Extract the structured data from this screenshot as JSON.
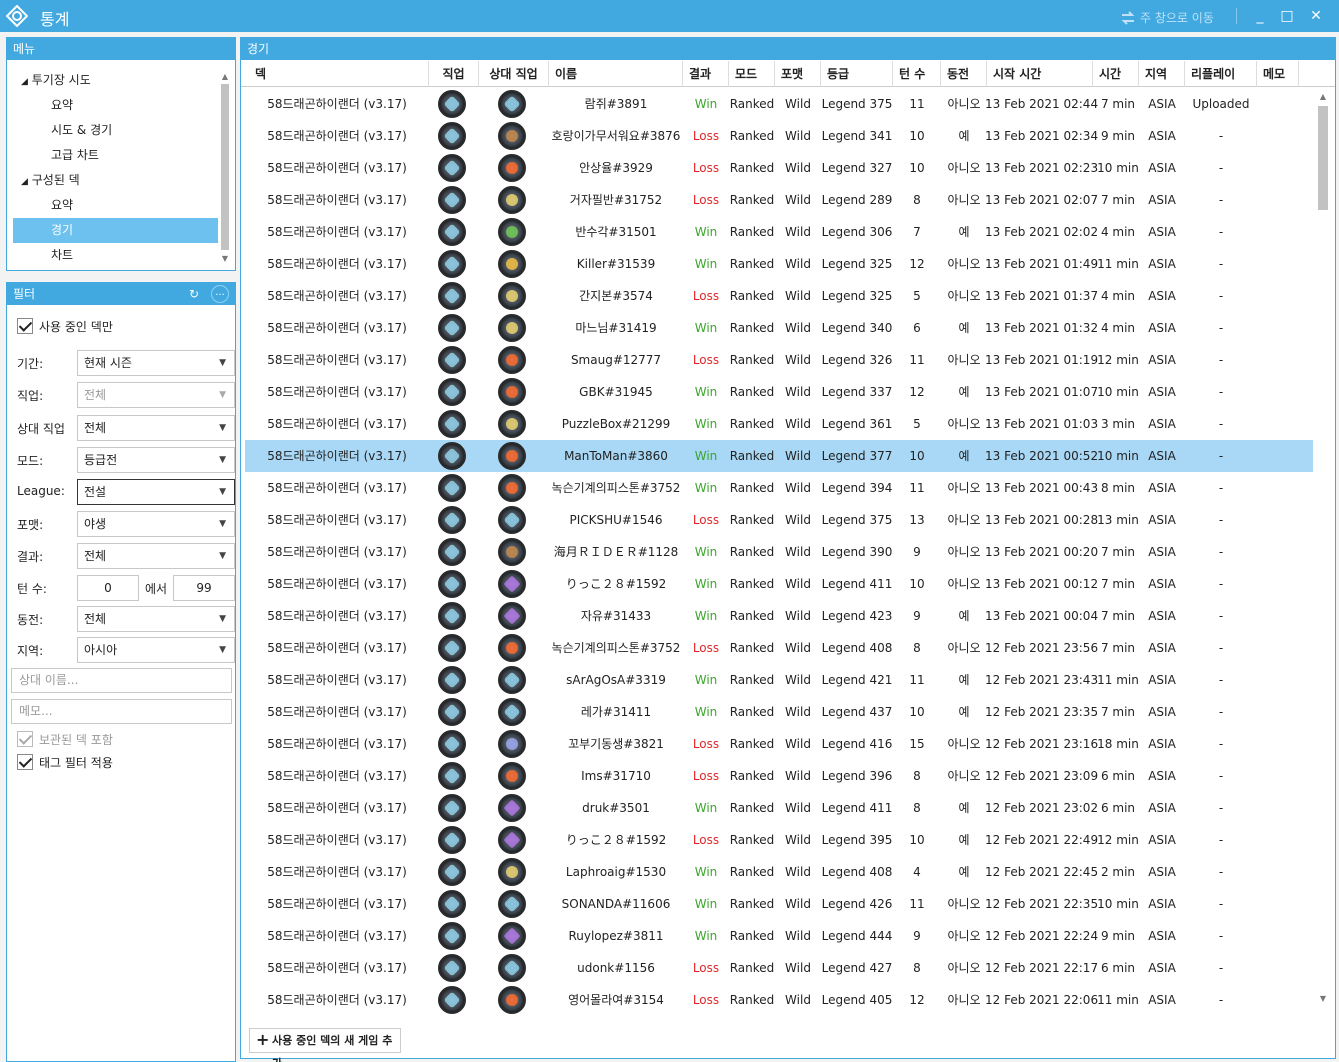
{
  "window": {
    "title": "통계",
    "goto_main": "주 창으로 이동",
    "minimize": "_",
    "maximize": "□",
    "close": "✕"
  },
  "menu": {
    "header": "메뉴",
    "items": [
      {
        "label": "투기장 시도",
        "expander": "◢"
      },
      {
        "label": "요약"
      },
      {
        "label": "시도 & 경기"
      },
      {
        "label": "고급 차트"
      },
      {
        "label": "구성된 덱",
        "expander": "◢"
      },
      {
        "label": "요약"
      },
      {
        "label": "경기"
      },
      {
        "label": "차트"
      }
    ]
  },
  "filter": {
    "header": "필터",
    "refresh_icon": "↻",
    "more": "...",
    "active_deck_only": "사용 중인 덱만",
    "period_label": "기간:",
    "period_value": "현재 시즌",
    "class_label": "직업:",
    "class_value": "전체",
    "opp_class_label": "상대 직업",
    "opp_class_value": "전체",
    "mode_label": "모드:",
    "mode_value": "등급전",
    "league_label": "League:",
    "league_value": "전설",
    "format_label": "포맷:",
    "format_value": "야생",
    "result_label": "결과:",
    "result_value": "전체",
    "turns_label": "턴 수:",
    "turns_from": "0",
    "turns_sep": "에서",
    "turns_to": "99",
    "coin_label": "동전:",
    "coin_value": "전체",
    "region_label": "지역:",
    "region_value": "아시아",
    "opponent_placeholder": "상대 이름...",
    "note_placeholder": "메모...",
    "include_archived": "보관된 덱 포함",
    "apply_tag_filter": "태그 필터 적용"
  },
  "games": {
    "header": "경기",
    "columns": [
      "덱",
      "직업",
      "상대 직업",
      "이름",
      "결과",
      "모드",
      "포맷",
      "등급",
      "턴 수",
      "동전",
      "시작 시간",
      "시간",
      "지역",
      "리플레이",
      "메모"
    ],
    "add_button": "사용 중인 덱의 새 게임 추가",
    "selected_index": 11,
    "rows": [
      {
        "deck": "58드래곤하이랜더 (v3.17)",
        "cls": "mage",
        "opp": "mage",
        "name": "람쥐#3891",
        "result": "Win",
        "mode": "Ranked",
        "format": "Wild",
        "rank": "Legend 375",
        "turns": "11",
        "coin": "아니오",
        "start": "13 Feb 2021 02:44",
        "duration": "7 min",
        "region": "ASIA",
        "replay": "Uploaded"
      },
      {
        "deck": "58드래곤하이랜더 (v3.17)",
        "cls": "mage",
        "opp": "rogue",
        "name": "호랑이가무서워요#3876",
        "result": "Loss",
        "mode": "Ranked",
        "format": "Wild",
        "rank": "Legend 341",
        "turns": "10",
        "coin": "예",
        "start": "13 Feb 2021 02:34",
        "duration": "9 min",
        "region": "ASIA",
        "replay": "-"
      },
      {
        "deck": "58드래곤하이랜더 (v3.17)",
        "cls": "mage",
        "opp": "warlock",
        "name": "안상율#3929",
        "result": "Loss",
        "mode": "Ranked",
        "format": "Wild",
        "rank": "Legend 327",
        "turns": "10",
        "coin": "아니오",
        "start": "13 Feb 2021 02:23",
        "duration": "10 min",
        "region": "ASIA",
        "replay": "-"
      },
      {
        "deck": "58드래곤하이랜더 (v3.17)",
        "cls": "mage",
        "opp": "druid",
        "name": "거자필반#31752",
        "result": "Loss",
        "mode": "Ranked",
        "format": "Wild",
        "rank": "Legend 289",
        "turns": "8",
        "coin": "아니오",
        "start": "13 Feb 2021 02:07",
        "duration": "7 min",
        "region": "ASIA",
        "replay": "-"
      },
      {
        "deck": "58드래곤하이랜더 (v3.17)",
        "cls": "mage",
        "opp": "hunter",
        "name": "반수각#31501",
        "result": "Win",
        "mode": "Ranked",
        "format": "Wild",
        "rank": "Legend 306",
        "turns": "7",
        "coin": "예",
        "start": "13 Feb 2021 02:02",
        "duration": "4 min",
        "region": "ASIA",
        "replay": "-"
      },
      {
        "deck": "58드래곤하이랜더 (v3.17)",
        "cls": "mage",
        "opp": "paladin",
        "name": "Killer#31539",
        "result": "Win",
        "mode": "Ranked",
        "format": "Wild",
        "rank": "Legend 325",
        "turns": "12",
        "coin": "아니오",
        "start": "13 Feb 2021 01:49",
        "duration": "11 min",
        "region": "ASIA",
        "replay": "-"
      },
      {
        "deck": "58드래곤하이랜더 (v3.17)",
        "cls": "mage",
        "opp": "druid",
        "name": "간지본#3574",
        "result": "Loss",
        "mode": "Ranked",
        "format": "Wild",
        "rank": "Legend 325",
        "turns": "5",
        "coin": "아니오",
        "start": "13 Feb 2021 01:37",
        "duration": "4 min",
        "region": "ASIA",
        "replay": "-"
      },
      {
        "deck": "58드래곤하이랜더 (v3.17)",
        "cls": "mage",
        "opp": "druid",
        "name": "마느님#31419",
        "result": "Win",
        "mode": "Ranked",
        "format": "Wild",
        "rank": "Legend 340",
        "turns": "6",
        "coin": "예",
        "start": "13 Feb 2021 01:32",
        "duration": "4 min",
        "region": "ASIA",
        "replay": "-"
      },
      {
        "deck": "58드래곤하이랜더 (v3.17)",
        "cls": "mage",
        "opp": "warlock",
        "name": "Smaug#12777",
        "result": "Loss",
        "mode": "Ranked",
        "format": "Wild",
        "rank": "Legend 326",
        "turns": "11",
        "coin": "아니오",
        "start": "13 Feb 2021 01:19",
        "duration": "12 min",
        "region": "ASIA",
        "replay": "-"
      },
      {
        "deck": "58드래곤하이랜더 (v3.17)",
        "cls": "mage",
        "opp": "warlock",
        "name": "GBK#31945",
        "result": "Win",
        "mode": "Ranked",
        "format": "Wild",
        "rank": "Legend 337",
        "turns": "12",
        "coin": "예",
        "start": "13 Feb 2021 01:07",
        "duration": "10 min",
        "region": "ASIA",
        "replay": "-"
      },
      {
        "deck": "58드래곤하이랜더 (v3.17)",
        "cls": "mage",
        "opp": "druid",
        "name": "PuzzleBox#21299",
        "result": "Win",
        "mode": "Ranked",
        "format": "Wild",
        "rank": "Legend 361",
        "turns": "5",
        "coin": "아니오",
        "start": "13 Feb 2021 01:03",
        "duration": "3 min",
        "region": "ASIA",
        "replay": "-"
      },
      {
        "deck": "58드래곤하이랜더 (v3.17)",
        "cls": "mage",
        "opp": "warlock",
        "name": "ManToMan#3860",
        "result": "Win",
        "mode": "Ranked",
        "format": "Wild",
        "rank": "Legend 377",
        "turns": "10",
        "coin": "예",
        "start": "13 Feb 2021 00:52",
        "duration": "10 min",
        "region": "ASIA",
        "replay": "-"
      },
      {
        "deck": "58드래곤하이랜더 (v3.17)",
        "cls": "mage",
        "opp": "warlock",
        "name": "녹슨기계의피스톤#3752",
        "result": "Win",
        "mode": "Ranked",
        "format": "Wild",
        "rank": "Legend 394",
        "turns": "11",
        "coin": "아니오",
        "start": "13 Feb 2021 00:43",
        "duration": "8 min",
        "region": "ASIA",
        "replay": "-"
      },
      {
        "deck": "58드래곤하이랜더 (v3.17)",
        "cls": "mage",
        "opp": "mage",
        "name": "PICKSHU#1546",
        "result": "Loss",
        "mode": "Ranked",
        "format": "Wild",
        "rank": "Legend 375",
        "turns": "13",
        "coin": "아니오",
        "start": "13 Feb 2021 00:28",
        "duration": "13 min",
        "region": "ASIA",
        "replay": "-"
      },
      {
        "deck": "58드래곤하이랜더 (v3.17)",
        "cls": "mage",
        "opp": "rogue",
        "name": "海月ＲＩＤＥＲ#1128",
        "result": "Win",
        "mode": "Ranked",
        "format": "Wild",
        "rank": "Legend 390",
        "turns": "9",
        "coin": "아니오",
        "start": "13 Feb 2021 00:20",
        "duration": "7 min",
        "region": "ASIA",
        "replay": "-"
      },
      {
        "deck": "58드래곤하이랜더 (v3.17)",
        "cls": "mage",
        "opp": "shaman",
        "name": "りっこ２８#1592",
        "result": "Win",
        "mode": "Ranked",
        "format": "Wild",
        "rank": "Legend 411",
        "turns": "10",
        "coin": "아니오",
        "start": "13 Feb 2021 00:12",
        "duration": "7 min",
        "region": "ASIA",
        "replay": "-"
      },
      {
        "deck": "58드래곤하이랜더 (v3.17)",
        "cls": "mage",
        "opp": "shaman",
        "name": "자유#31433",
        "result": "Win",
        "mode": "Ranked",
        "format": "Wild",
        "rank": "Legend 423",
        "turns": "9",
        "coin": "예",
        "start": "13 Feb 2021 00:04",
        "duration": "7 min",
        "region": "ASIA",
        "replay": "-"
      },
      {
        "deck": "58드래곤하이랜더 (v3.17)",
        "cls": "mage",
        "opp": "warlock",
        "name": "녹슨기계의피스톤#3752",
        "result": "Loss",
        "mode": "Ranked",
        "format": "Wild",
        "rank": "Legend 408",
        "turns": "8",
        "coin": "아니오",
        "start": "12 Feb 2021 23:56",
        "duration": "7 min",
        "region": "ASIA",
        "replay": "-"
      },
      {
        "deck": "58드래곤하이랜더 (v3.17)",
        "cls": "mage",
        "opp": "mage",
        "name": "sArAgOsA#3319",
        "result": "Win",
        "mode": "Ranked",
        "format": "Wild",
        "rank": "Legend 421",
        "turns": "11",
        "coin": "예",
        "start": "12 Feb 2021 23:43",
        "duration": "11 min",
        "region": "ASIA",
        "replay": "-"
      },
      {
        "deck": "58드래곤하이랜더 (v3.17)",
        "cls": "mage",
        "opp": "mage",
        "name": "레가#31411",
        "result": "Win",
        "mode": "Ranked",
        "format": "Wild",
        "rank": "Legend 437",
        "turns": "10",
        "coin": "예",
        "start": "12 Feb 2021 23:35",
        "duration": "7 min",
        "region": "ASIA",
        "replay": "-"
      },
      {
        "deck": "58드래곤하이랜더 (v3.17)",
        "cls": "mage",
        "opp": "priest",
        "name": "꼬부기동생#3821",
        "result": "Loss",
        "mode": "Ranked",
        "format": "Wild",
        "rank": "Legend 416",
        "turns": "15",
        "coin": "아니오",
        "start": "12 Feb 2021 23:16",
        "duration": "18 min",
        "region": "ASIA",
        "replay": "-"
      },
      {
        "deck": "58드래곤하이랜더 (v3.17)",
        "cls": "mage",
        "opp": "warlock",
        "name": "Ims#31710",
        "result": "Loss",
        "mode": "Ranked",
        "format": "Wild",
        "rank": "Legend 396",
        "turns": "8",
        "coin": "아니오",
        "start": "12 Feb 2021 23:09",
        "duration": "6 min",
        "region": "ASIA",
        "replay": "-"
      },
      {
        "deck": "58드래곤하이랜더 (v3.17)",
        "cls": "mage",
        "opp": "shaman",
        "name": "druk#3501",
        "result": "Win",
        "mode": "Ranked",
        "format": "Wild",
        "rank": "Legend 411",
        "turns": "8",
        "coin": "예",
        "start": "12 Feb 2021 23:02",
        "duration": "6 min",
        "region": "ASIA",
        "replay": "-"
      },
      {
        "deck": "58드래곤하이랜더 (v3.17)",
        "cls": "mage",
        "opp": "shaman",
        "name": "りっこ２８#1592",
        "result": "Loss",
        "mode": "Ranked",
        "format": "Wild",
        "rank": "Legend 395",
        "turns": "10",
        "coin": "예",
        "start": "12 Feb 2021 22:49",
        "duration": "12 min",
        "region": "ASIA",
        "replay": "-"
      },
      {
        "deck": "58드래곤하이랜더 (v3.17)",
        "cls": "mage",
        "opp": "druid",
        "name": "Laphroaig#1530",
        "result": "Win",
        "mode": "Ranked",
        "format": "Wild",
        "rank": "Legend 408",
        "turns": "4",
        "coin": "예",
        "start": "12 Feb 2021 22:45",
        "duration": "2 min",
        "region": "ASIA",
        "replay": "-"
      },
      {
        "deck": "58드래곤하이랜더 (v3.17)",
        "cls": "mage",
        "opp": "mage",
        "name": "SONANDA#11606",
        "result": "Win",
        "mode": "Ranked",
        "format": "Wild",
        "rank": "Legend 426",
        "turns": "11",
        "coin": "아니오",
        "start": "12 Feb 2021 22:35",
        "duration": "10 min",
        "region": "ASIA",
        "replay": "-"
      },
      {
        "deck": "58드래곤하이랜더 (v3.17)",
        "cls": "mage",
        "opp": "shaman",
        "name": "Ruylopez#3811",
        "result": "Win",
        "mode": "Ranked",
        "format": "Wild",
        "rank": "Legend 444",
        "turns": "9",
        "coin": "아니오",
        "start": "12 Feb 2021 22:24",
        "duration": "9 min",
        "region": "ASIA",
        "replay": "-"
      },
      {
        "deck": "58드래곤하이랜더 (v3.17)",
        "cls": "mage",
        "opp": "mage",
        "name": "udonk#1156",
        "result": "Loss",
        "mode": "Ranked",
        "format": "Wild",
        "rank": "Legend 427",
        "turns": "8",
        "coin": "아니오",
        "start": "12 Feb 2021 22:17",
        "duration": "6 min",
        "region": "ASIA",
        "replay": "-"
      },
      {
        "deck": "58드래곤하이랜더 (v3.17)",
        "cls": "mage",
        "opp": "warlock",
        "name": "영어몰라여#3154",
        "result": "Loss",
        "mode": "Ranked",
        "format": "Wild",
        "rank": "Legend 405",
        "turns": "12",
        "coin": "아니오",
        "start": "12 Feb 2021 22:06",
        "duration": "11 min",
        "region": "ASIA",
        "replay": "-"
      }
    ]
  },
  "colors": {
    "accent": "#41a9e0",
    "selection": "#a8d8f5",
    "menu_selection": "#6cc1ef",
    "win": "#3aa52a",
    "loss": "#e0282a"
  }
}
